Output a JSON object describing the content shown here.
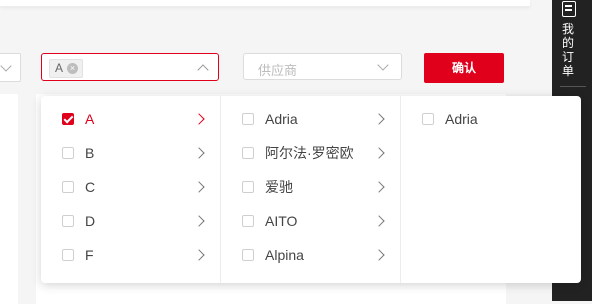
{
  "filters": {
    "brand_tag": "A",
    "brand_tag_close": "×",
    "supplier_placeholder": "供应商",
    "confirm_label": "确认"
  },
  "side_panel": {
    "label": "我的订单",
    "icon": "document-icon"
  },
  "cascader": {
    "level1": [
      {
        "label": "A",
        "checked": true,
        "active": true
      },
      {
        "label": "B",
        "checked": false
      },
      {
        "label": "C",
        "checked": false
      },
      {
        "label": "D",
        "checked": false
      },
      {
        "label": "F",
        "checked": false
      }
    ],
    "level2": [
      {
        "label": "Adria"
      },
      {
        "label": "阿尔法·罗密欧"
      },
      {
        "label": "爱驰"
      },
      {
        "label": "AITO"
      },
      {
        "label": "Alpina"
      }
    ],
    "level3": [
      {
        "label": "Adria"
      }
    ]
  },
  "colors": {
    "accent": "#e0001b",
    "side_panel_bg": "#222222"
  }
}
